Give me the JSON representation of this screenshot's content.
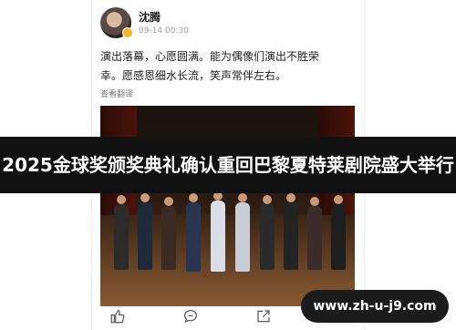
{
  "post": {
    "username": "沈腾",
    "time": "09-14 00:30",
    "text_line1": "演出落幕，心愿圆满。能为偶像们演出不胜荣",
    "text_line2": "幸。愿感恩细水长流，笑声常伴左右。",
    "translate_label": "查看翻译"
  },
  "headline": "2025金球奖颁奖典礼确认重回巴黎夏特莱剧院盛大举行",
  "watermark": "www.zh-u-j9.com",
  "actions": {
    "icons": [
      "thumbs-up-icon",
      "comment-icon",
      "share-icon",
      "more-icon"
    ]
  },
  "colors": {
    "banner": "#111111",
    "verified_badge": "#f5b623",
    "watermark_bg": "#1c1c1c"
  }
}
